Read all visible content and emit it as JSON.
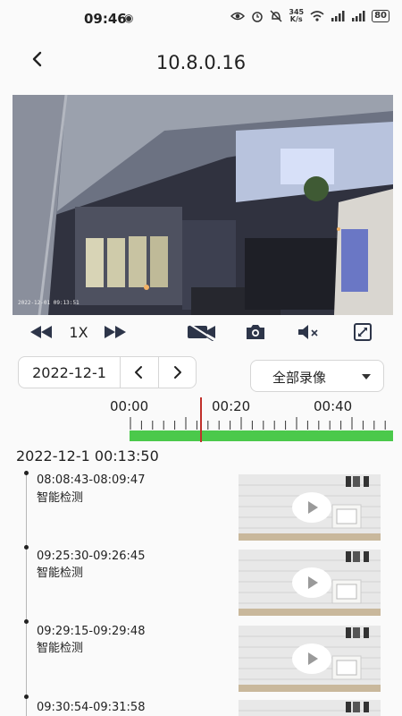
{
  "status_bar": {
    "time": "09:46",
    "network_speed_value": "345",
    "network_speed_unit": "K/s",
    "battery": "80"
  },
  "header": {
    "title": "10.8.0.16"
  },
  "video": {
    "timestamp_overlay": "2022-12-01 09:13:51"
  },
  "player": {
    "speed": "1X"
  },
  "date_picker": {
    "date": "2022-12-1"
  },
  "filter": {
    "label": "全部录像"
  },
  "timeline": {
    "labels": [
      "00:00",
      "00:20",
      "00:40"
    ],
    "current_position_seconds": 13.8,
    "colors": {
      "recording": "#4bc94b",
      "cursor": "#c0302b"
    }
  },
  "recordings": {
    "date_time": "2022-12-1 00:13:50",
    "items": [
      {
        "time_range": "08:08:43-08:09:47",
        "type": "智能检测"
      },
      {
        "time_range": "09:25:30-09:26:45",
        "type": "智能检测"
      },
      {
        "time_range": "09:29:15-09:29:48",
        "type": "智能检测"
      },
      {
        "time_range": "09:30:54-09:31:58",
        "type": ""
      }
    ]
  }
}
